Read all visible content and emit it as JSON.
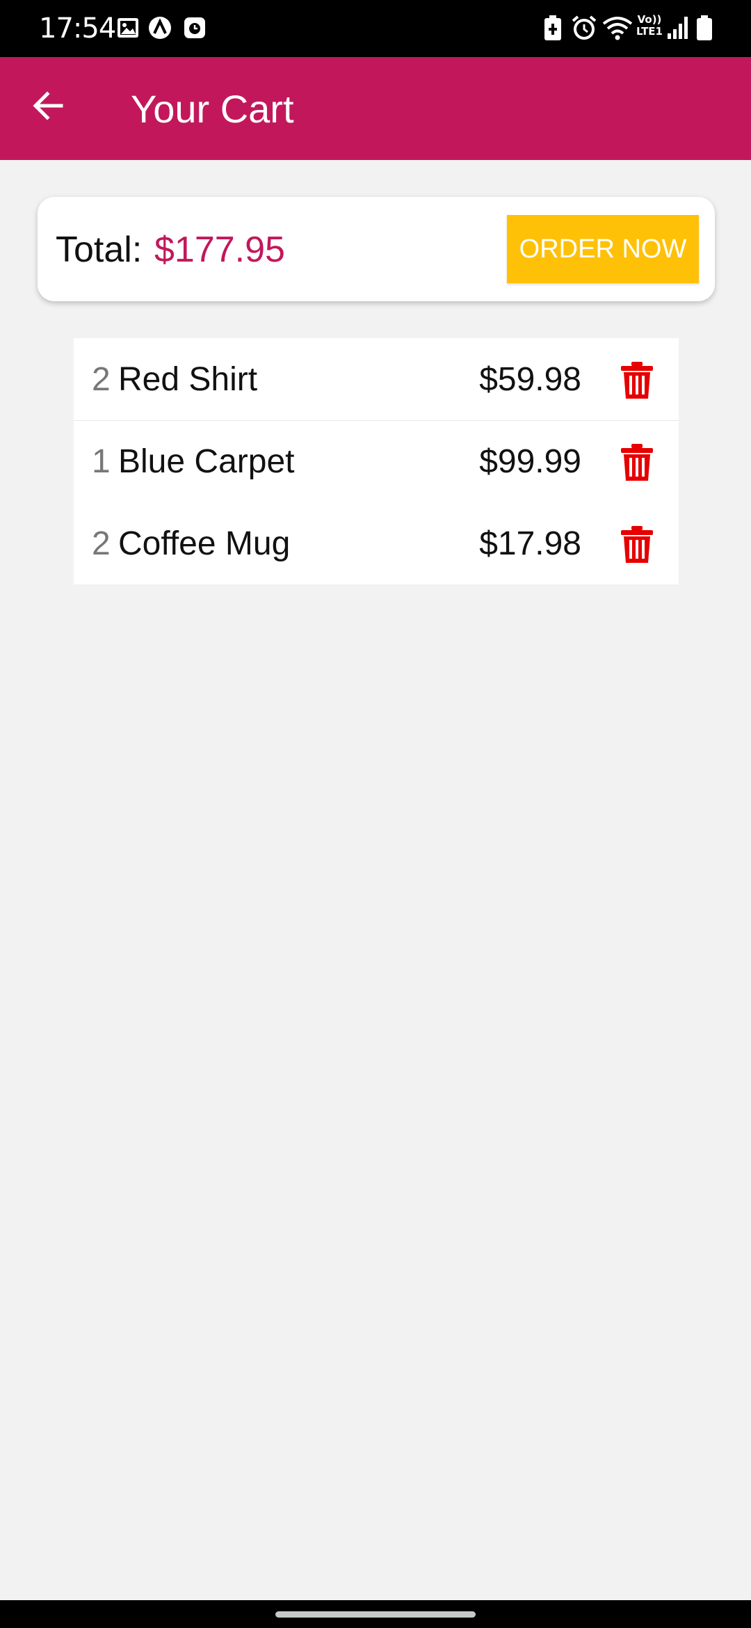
{
  "status_bar": {
    "time": "17:54",
    "left_icons": [
      "image-icon",
      "app-icon",
      "clock-badge-icon"
    ],
    "right_icons": [
      "battery-saver-icon",
      "alarm-icon",
      "wifi-icon",
      "volte-lte-icon",
      "signal-icon",
      "battery-icon"
    ],
    "network_label": "Vo)) LTE1"
  },
  "app_bar": {
    "title": "Your Cart",
    "background": "#c2185b"
  },
  "summary": {
    "total_label": "Total:",
    "total_amount": "$177.95",
    "order_button": "ORDER NOW",
    "order_button_color": "#ffc107"
  },
  "cart": {
    "items": [
      {
        "qty": "2",
        "name": "Red Shirt",
        "price": "$59.98"
      },
      {
        "qty": "1",
        "name": "Blue Carpet",
        "price": "$99.99"
      },
      {
        "qty": "2",
        "name": "Coffee Mug",
        "price": "$17.98"
      }
    ],
    "delete_icon": "trash-icon",
    "delete_color": "#e60000"
  }
}
